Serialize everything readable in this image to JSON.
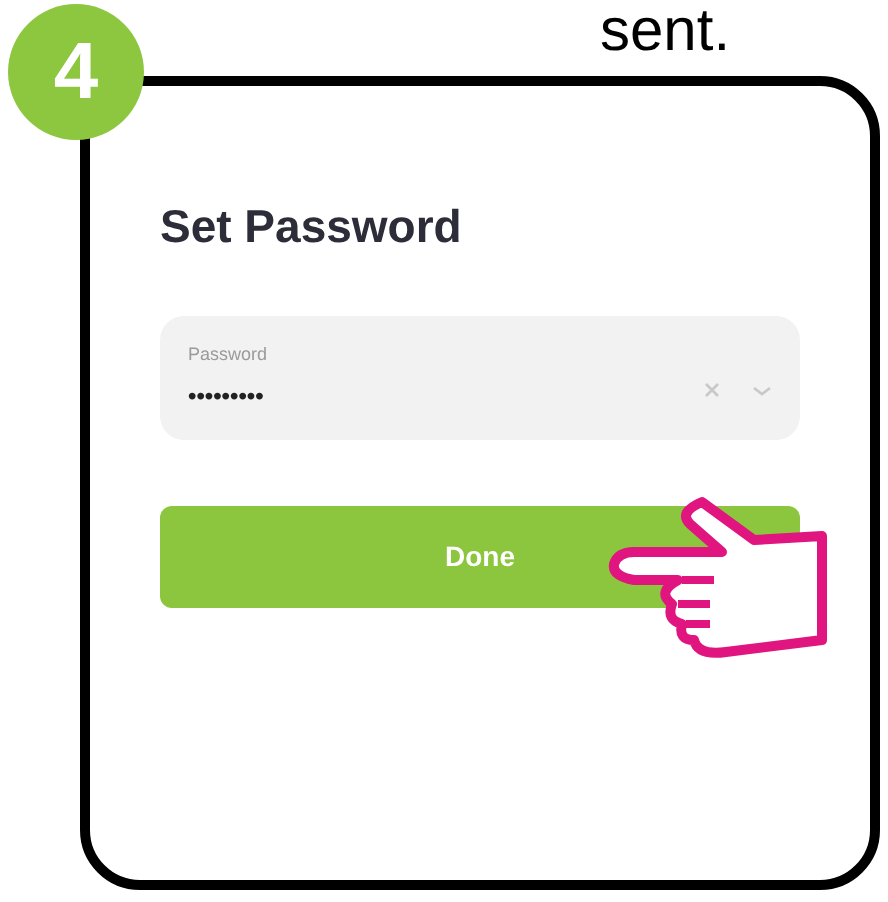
{
  "caption": "sent.",
  "step_badge": "4",
  "screen": {
    "title": "Set Password",
    "password_field": {
      "label": "Password",
      "value": "•••••••••"
    },
    "done_button": "Done"
  }
}
